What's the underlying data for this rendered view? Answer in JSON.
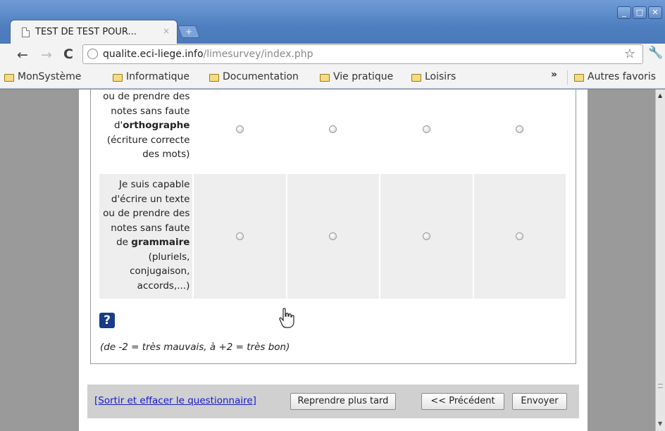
{
  "browser": {
    "tab_title": "TEST DE TEST POUR...",
    "tab_close": "×",
    "new_tab": "+",
    "window_buttons": [
      "_",
      "□",
      "✕"
    ],
    "url_host": "qualite.eci-liege.info",
    "url_path": "/limesurvey/index.php",
    "bookmarks": [
      "MonSystème",
      "Informatique",
      "Documentation",
      "Vie pratique",
      "Loisirs"
    ],
    "bookmarks_overflow": "»",
    "other_bookmarks": "Autres favoris",
    "icons": {
      "back": "←",
      "forward": "→",
      "reload": "C",
      "star": "☆",
      "wrench": "🔧"
    }
  },
  "survey": {
    "row_a": {
      "text_pre": "ou de prendre des notes sans faute d'",
      "text_bold": "orthographe",
      "text_post": " (écriture correcte des mots)"
    },
    "row_b": {
      "text_pre": "Je suis capable d'écrire un texte ou de prendre des notes sans faute de ",
      "text_bold": "grammaire",
      "text_post": " (pluriels, conjugaison, accords,...)"
    },
    "help_icon": "?",
    "scale_note": "(de -2 = très mauvais, à +2 = très bon)"
  },
  "navigation": {
    "quit_link": "[Sortir et effacer le questionnaire]",
    "resume_later": "Reprendre plus tard",
    "previous": "<< Précédent",
    "submit": "Envoyer"
  }
}
